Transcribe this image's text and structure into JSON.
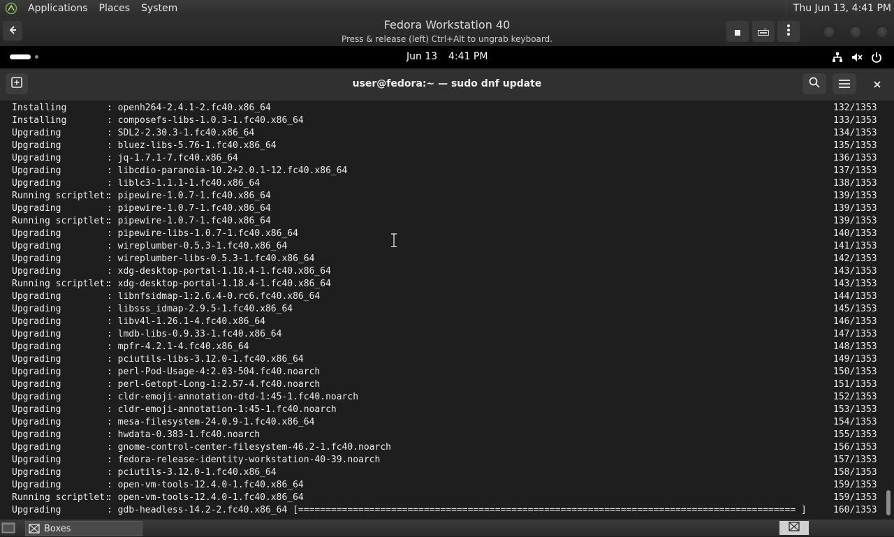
{
  "host_panel": {
    "menus": [
      "Applications",
      "Places",
      "System"
    ],
    "clock": "Thu Jun 13,  4:41 PM"
  },
  "boxes": {
    "title": "Fedora Workstation 40",
    "subtitle": "Press & release (left) Ctrl+Alt to ungrab keyboard."
  },
  "gnome_bar": {
    "date": "Jun 13",
    "time": "4:41 PM"
  },
  "terminal": {
    "title": "user@fedora:~ — sudo dnf update",
    "lines": [
      {
        "action": "Installing",
        "package": "openh264-2.4.1-2.fc40.x86_64",
        "count": "132/1353"
      },
      {
        "action": "Installing",
        "package": "composefs-libs-1.0.3-1.fc40.x86_64",
        "count": "133/1353"
      },
      {
        "action": "Upgrading",
        "package": "SDL2-2.30.3-1.fc40.x86_64",
        "count": "134/1353"
      },
      {
        "action": "Upgrading",
        "package": "bluez-libs-5.76-1.fc40.x86_64",
        "count": "135/1353"
      },
      {
        "action": "Upgrading",
        "package": "jq-1.7.1-7.fc40.x86_64",
        "count": "136/1353"
      },
      {
        "action": "Upgrading",
        "package": "libcdio-paranoia-10.2+2.0.1-12.fc40.x86_64",
        "count": "137/1353"
      },
      {
        "action": "Upgrading",
        "package": "liblc3-1.1.1-1.fc40.x86_64",
        "count": "138/1353"
      },
      {
        "action": "Running scriptlet:",
        "package": "pipewire-1.0.7-1.fc40.x86_64",
        "count": "139/1353"
      },
      {
        "action": "Upgrading",
        "package": "pipewire-1.0.7-1.fc40.x86_64",
        "count": "139/1353"
      },
      {
        "action": "Running scriptlet:",
        "package": "pipewire-1.0.7-1.fc40.x86_64",
        "count": "139/1353"
      },
      {
        "action": "Upgrading",
        "package": "pipewire-libs-1.0.7-1.fc40.x86_64",
        "count": "140/1353"
      },
      {
        "action": "Upgrading",
        "package": "wireplumber-0.5.3-1.fc40.x86_64",
        "count": "141/1353"
      },
      {
        "action": "Upgrading",
        "package": "wireplumber-libs-0.5.3-1.fc40.x86_64",
        "count": "142/1353"
      },
      {
        "action": "Upgrading",
        "package": "xdg-desktop-portal-1.18.4-1.fc40.x86_64",
        "count": "143/1353"
      },
      {
        "action": "Running scriptlet:",
        "package": "xdg-desktop-portal-1.18.4-1.fc40.x86_64",
        "count": "143/1353"
      },
      {
        "action": "Upgrading",
        "package": "libnfsidmap-1:2.6.4-0.rc6.fc40.x86_64",
        "count": "144/1353"
      },
      {
        "action": "Upgrading",
        "package": "libsss_idmap-2.9.5-1.fc40.x86_64",
        "count": "145/1353"
      },
      {
        "action": "Upgrading",
        "package": "libv4l-1.26.1-4.fc40.x86_64",
        "count": "146/1353"
      },
      {
        "action": "Upgrading",
        "package": "lmdb-libs-0.9.33-1.fc40.x86_64",
        "count": "147/1353"
      },
      {
        "action": "Upgrading",
        "package": "mpfr-4.2.1-4.fc40.x86_64",
        "count": "148/1353"
      },
      {
        "action": "Upgrading",
        "package": "pciutils-libs-3.12.0-1.fc40.x86_64",
        "count": "149/1353"
      },
      {
        "action": "Upgrading",
        "package": "perl-Pod-Usage-4:2.03-504.fc40.noarch",
        "count": "150/1353"
      },
      {
        "action": "Upgrading",
        "package": "perl-Getopt-Long-1:2.57-4.fc40.noarch",
        "count": "151/1353"
      },
      {
        "action": "Upgrading",
        "package": "cldr-emoji-annotation-dtd-1:45-1.fc40.noarch",
        "count": "152/1353"
      },
      {
        "action": "Upgrading",
        "package": "cldr-emoji-annotation-1:45-1.fc40.noarch",
        "count": "153/1353"
      },
      {
        "action": "Upgrading",
        "package": "mesa-filesystem-24.0.9-1.fc40.x86_64",
        "count": "154/1353"
      },
      {
        "action": "Upgrading",
        "package": "hwdata-0.383-1.fc40.noarch",
        "count": "155/1353"
      },
      {
        "action": "Upgrading",
        "package": "gnome-control-center-filesystem-46.2-1.fc40.noarch",
        "count": "156/1353"
      },
      {
        "action": "Upgrading",
        "package": "fedora-release-identity-workstation-40-39.noarch",
        "count": "157/1353"
      },
      {
        "action": "Upgrading",
        "package": "pciutils-3.12.0-1.fc40.x86_64",
        "count": "158/1353"
      },
      {
        "action": "Upgrading",
        "package": "open-vm-tools-12.4.0-1.fc40.x86_64",
        "count": "159/1353"
      },
      {
        "action": "Running scriptlet:",
        "package": "open-vm-tools-12.4.0-1.fc40.x86_64",
        "count": "159/1353"
      },
      {
        "action": "Upgrading",
        "package": "gdb-headless-14.2-2.fc40.x86_64 [=========================================================================================== ]",
        "count": "160/1353"
      }
    ]
  },
  "taskbar": {
    "task_label": "Boxes"
  },
  "icons": {
    "host_logo": "mate-logo-icon",
    "back": "back-arrow-icon",
    "new_tab": "new-tab-icon",
    "search": "search-icon",
    "menu": "hamburger-menu-icon",
    "close": "close-icon",
    "network": "network-icon",
    "volume": "volume-muted-icon",
    "power": "power-icon"
  },
  "colors": {
    "terminal_bg": "#1e1e1e",
    "terminal_fg": "#ececec",
    "header_bg": "#303030",
    "gnome_bar_bg": "#000000"
  }
}
